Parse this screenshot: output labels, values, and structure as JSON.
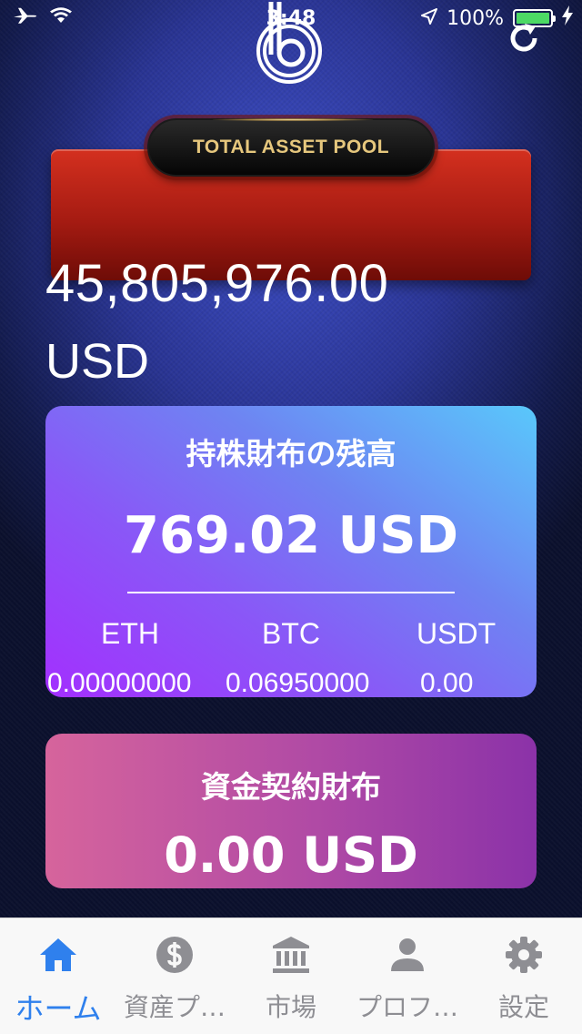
{
  "status_bar": {
    "time": "3:48",
    "battery": "100%"
  },
  "header": {
    "logo_icon": "b-logo-icon",
    "refresh_icon": "refresh-icon"
  },
  "total_pool": {
    "label": "TOTAL ASSET POOL",
    "amount": "45,805,976.00",
    "currency": "USD"
  },
  "stake_wallet": {
    "title": "持株財布の残高",
    "amount": "769.02 USD",
    "coins": [
      {
        "label": "ETH",
        "value": "0.00000000"
      },
      {
        "label": "BTC",
        "value": "0.06950000"
      },
      {
        "label": "USDT",
        "value": "0.00"
      }
    ]
  },
  "contract_wallet": {
    "title": "資金契約財布",
    "amount": "0.00 USD"
  },
  "tab_bar": {
    "tabs": [
      {
        "label": "ホーム",
        "icon": "home-icon",
        "active": true
      },
      {
        "label": "資産プ…",
        "icon": "dollar-icon",
        "active": false
      },
      {
        "label": "市場",
        "icon": "bank-icon",
        "active": false
      },
      {
        "label": "プロフ…",
        "icon": "person-icon",
        "active": false
      },
      {
        "label": "設定",
        "icon": "gear-icon",
        "active": false
      }
    ],
    "active_color": "#2f80ed",
    "inactive_color": "#8e8e93"
  }
}
